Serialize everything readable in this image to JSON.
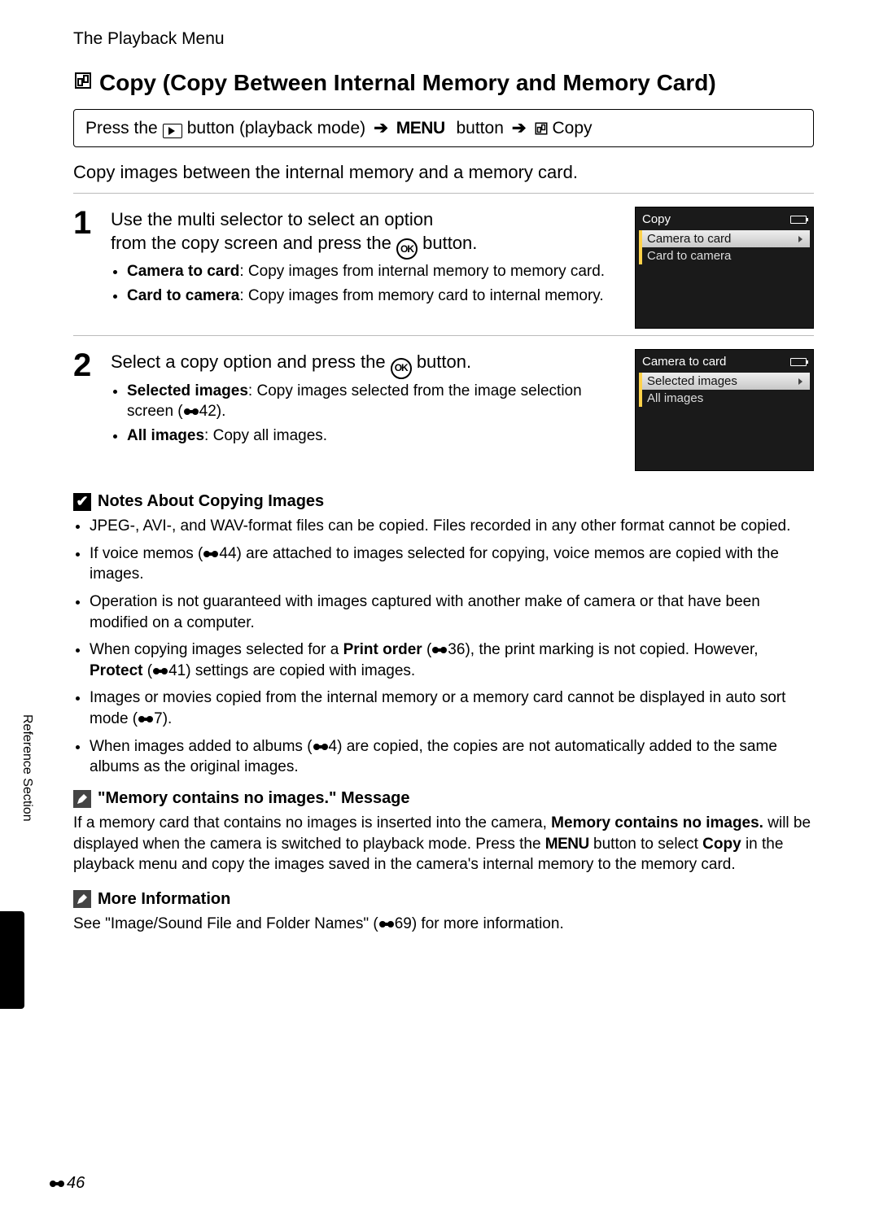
{
  "breadcrumb": "The Playback Menu",
  "title": "Copy (Copy Between Internal Memory and Memory Card)",
  "path": {
    "prefix": "Press the",
    "playback_label": "button (playback mode)",
    "menu_word": "MENU",
    "menu_suffix": "button",
    "copy_label": "Copy"
  },
  "intro": "Copy images between the internal memory and a memory card.",
  "steps": [
    {
      "num": "1",
      "lead_a": "Use the multi selector to select an option",
      "lead_b": "from the copy screen and press the",
      "lead_c": "button.",
      "bullets": [
        {
          "bold": "Camera to card",
          "rest": ": Copy images from internal memory to memory card."
        },
        {
          "bold": "Card to camera",
          "rest": ": Copy images from memory card to internal memory."
        }
      ],
      "screen_title": "Copy",
      "screen_items": [
        "Camera to card",
        "Card to camera"
      ]
    },
    {
      "num": "2",
      "lead_a": "Select a copy option and press the",
      "lead_b": "button.",
      "bullets": [
        {
          "bold": "Selected images",
          "rest": ": Copy images selected from the image selection screen (",
          "ref": "42",
          "tail": ")."
        },
        {
          "bold": "All images",
          "rest": ": Copy all images."
        }
      ],
      "screen_title": "Camera to card",
      "screen_items": [
        "Selected images",
        "All images"
      ]
    }
  ],
  "notes_block": {
    "heading": "Notes About Copying Images",
    "items": [
      {
        "text": "JPEG-, AVI-, and WAV-format files can be copied. Files recorded in any other format cannot be copied."
      },
      {
        "pre": "If voice memos (",
        "ref": "44",
        "post": ") are attached to images selected for copying, voice memos are copied with the images."
      },
      {
        "text": "Operation is not guaranteed with images captured with another make of camera or that have been modified on a computer."
      },
      {
        "pre": "When copying images selected for a ",
        "bold1": "Print order",
        "mid1": " (",
        "ref1": "36",
        "mid2": "), the print marking is not copied. However, ",
        "bold2": "Protect",
        "mid3": " (",
        "ref2": "41",
        "mid4": ") settings are copied with images."
      },
      {
        "pre": "Images or movies copied from the internal memory or a memory card cannot be displayed in auto sort mode (",
        "ref": "7",
        "post": ")."
      },
      {
        "pre": "When images added to albums (",
        "ref": "4",
        "post": ") are copied, the copies are not automatically added to the same albums as the original images."
      }
    ]
  },
  "msg_block": {
    "heading": "\"Memory contains no images.\" Message",
    "p_pre": "If a memory card that contains no images is inserted into the camera, ",
    "p_bold1": "Memory contains no images.",
    "p_mid1": " will be displayed when the camera is switched to playback mode. Press the ",
    "p_menu": "MENU",
    "p_mid2": " button to select ",
    "p_bold2": "Copy",
    "p_tail": " in the playback menu and copy the images saved in the camera's internal memory to the memory card."
  },
  "more_block": {
    "heading": "More Information",
    "p_pre": "See \"Image/Sound File and Folder Names\" (",
    "ref": "69",
    "p_post": ") for more information."
  },
  "side_tab": "Reference Section",
  "page_number": "46"
}
